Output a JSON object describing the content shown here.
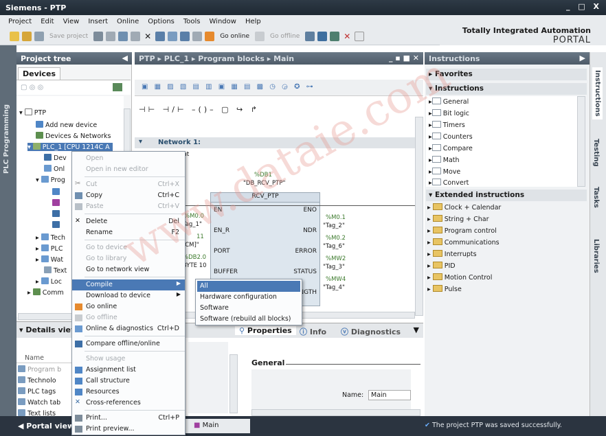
{
  "window": {
    "title": "Siemens  -  PTP",
    "controls": "_ □ X"
  },
  "menu": [
    "Project",
    "Edit",
    "View",
    "Insert",
    "Online",
    "Options",
    "Tools",
    "Window",
    "Help"
  ],
  "toolbar": {
    "save_project": "Save project",
    "go_online": "Go online",
    "go_offline": "Go offline"
  },
  "tia": {
    "line1": "Totally Integrated Automation",
    "line2": "PORTAL"
  },
  "left_strip": "PLC Programming",
  "project_tree": {
    "title": "Project tree",
    "tab": "Devices",
    "nodes": [
      "PTP",
      "Add new device",
      "Devices & Networks",
      "PLC_1 [CPU 1214C A",
      "Dev",
      "Onl",
      "Prog",
      "Tech",
      "PLC",
      "Wat",
      "Text",
      "Loc",
      "Comm"
    ]
  },
  "details": {
    "title": "Details view",
    "col_name": "Name",
    "rows": [
      "Program b",
      "Technolo",
      "PLC tags",
      "Watch tab",
      "Text lists"
    ]
  },
  "editor": {
    "breadcrumb": "PTP  ▸  PLC_1  ▸  Program blocks  ▸  Main",
    "network": "Network 1:",
    "comment_frag": "nt",
    "db_name": "%DB1",
    "db_label": "\"DB_RCV_PTP\"",
    "block_name": "RCV_PTP",
    "pins_left": [
      "EN",
      "EN_R",
      "PORT",
      "BUFFER"
    ],
    "pins_right": [
      "ENO",
      "NDR",
      "ERROR",
      "STATUS",
      "LENGTH"
    ],
    "operands_left": [
      "%M0.0",
      "\"Tag_1\"",
      "11",
      "\"[CM]\"",
      "%DB2.0",
      "\"BYTE 10"
    ],
    "operands_right": [
      "%M0.1",
      "\"Tag_2\"",
      "%M0.2",
      "\"Tag_6\"",
      "%MW2",
      "\"Tag_3\"",
      "%MW4",
      "\"Tag_4\""
    ]
  },
  "properties": {
    "tabs": [
      "Properties",
      "Info",
      "Diagnostics"
    ],
    "section": "General",
    "name_label": "Name:",
    "name_value": "Main"
  },
  "instructions": {
    "title": "Instructions",
    "favorites": "Favorites",
    "section1": "Instructions",
    "basic": [
      "General",
      "Bit logic",
      "Timers",
      "Counters",
      "Compare",
      "Math",
      "Move",
      "Convert"
    ],
    "section2": "Extended instructions",
    "extended": [
      "Clock + Calendar",
      "String + Char",
      "Program control",
      "Communications",
      "Interrupts",
      "PID",
      "Motion Control",
      "Pulse"
    ]
  },
  "right_tabs": [
    "Instructions",
    "Testing",
    "Tasks",
    "Libraries"
  ],
  "context_menu": {
    "items": [
      {
        "label": "Open",
        "disabled": true
      },
      {
        "label": "Open in new editor",
        "disabled": true
      },
      {
        "label": "Cut",
        "shortcut": "Ctrl+X",
        "disabled": true
      },
      {
        "label": "Copy",
        "shortcut": "Ctrl+C"
      },
      {
        "label": "Paste",
        "shortcut": "Ctrl+V",
        "disabled": true
      },
      {
        "label": "Delete",
        "shortcut": "Del"
      },
      {
        "label": "Rename",
        "shortcut": "F2"
      },
      {
        "label": "Go to device",
        "disabled": true
      },
      {
        "label": "Go to library",
        "disabled": true
      },
      {
        "label": "Go to network view"
      },
      {
        "label": "Compile",
        "selected": true
      },
      {
        "label": "Download to device"
      },
      {
        "label": "Go online"
      },
      {
        "label": "Go offline",
        "disabled": true
      },
      {
        "label": "Online & diagnostics",
        "shortcut": "Ctrl+D"
      },
      {
        "label": "Compare offline/online"
      },
      {
        "label": "Show usage",
        "disabled": true
      },
      {
        "label": "Assignment list"
      },
      {
        "label": "Call structure"
      },
      {
        "label": "Resources"
      },
      {
        "label": "Cross-references"
      },
      {
        "label": "Print...",
        "shortcut": "Ctrl+P"
      },
      {
        "label": "Print preview..."
      }
    ]
  },
  "compile_submenu": [
    "All",
    "Hardware configuration",
    "Software",
    "Software (rebuild all blocks)"
  ],
  "bottom": {
    "portal_view": "Portal view",
    "main_tab": "Main",
    "status": "The project PTP was saved successfully."
  },
  "watermark": "www.dataie.com",
  "colors": {
    "accent": "#4a79b5",
    "header": "#5f6c78",
    "title": "#1e2832"
  }
}
